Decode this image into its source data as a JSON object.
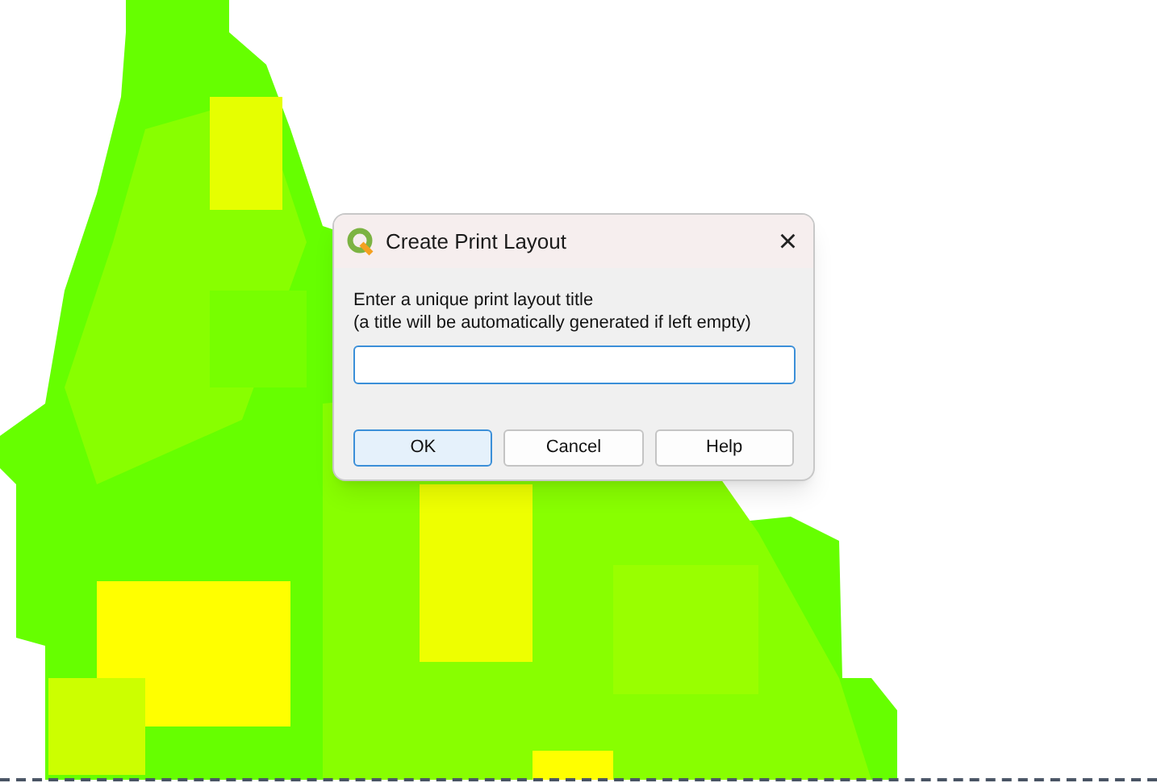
{
  "dialog": {
    "title": "Create Print Layout",
    "close": "×",
    "prompt": [
      "Enter a unique print layout title",
      "(a title will be automatically generated if left empty)"
    ],
    "title_field": {
      "focused": true
    },
    "buttons": [
      {
        "label": "OK",
        "default": true
      },
      {
        "label": "Cancel",
        "default": false
      },
      {
        "label": "Help",
        "default": false
      }
    ]
  }
}
